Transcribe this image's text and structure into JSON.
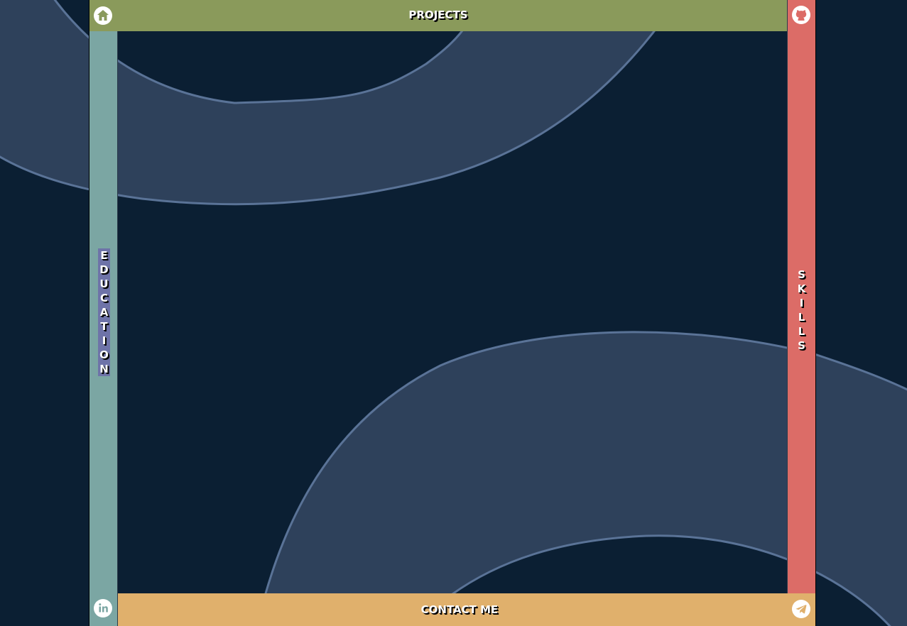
{
  "nav": {
    "top": {
      "label": "PROJECTS",
      "color": "#8a9a5b"
    },
    "left": {
      "label": "EDUCATION",
      "color": "#7ba6a3",
      "highlight": "#6e73a8"
    },
    "right": {
      "label": "SKILLS",
      "color": "#dc6c67"
    },
    "bottom": {
      "label": "CONTACT ME",
      "color": "#e0b06c"
    }
  },
  "icons": {
    "home": "home-icon",
    "github": "github-icon",
    "linkedin": "linkedin-icon",
    "telegram": "telegram-icon"
  },
  "colors": {
    "background": "#0b1f33",
    "shape_fill": "#2e415b",
    "shape_stroke": "#5a7397"
  }
}
